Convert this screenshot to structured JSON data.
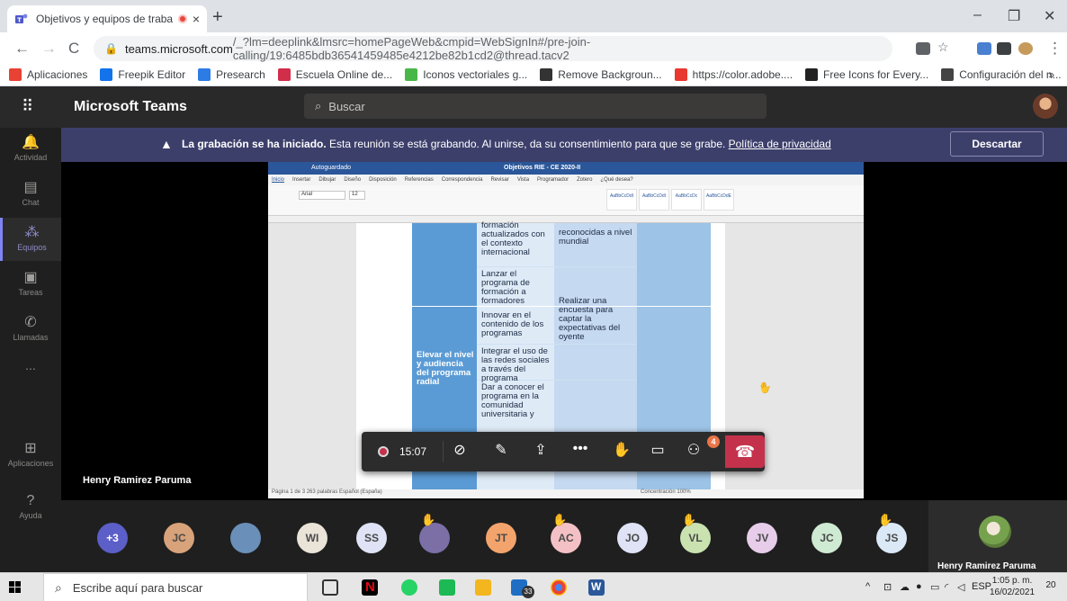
{
  "browser": {
    "tab_title": "Objetivos y equipos de traba",
    "tab_close": "×",
    "new_tab": "+",
    "win_minimize": "–",
    "win_restore": "❐",
    "win_close": "✕",
    "nav_back": "←",
    "nav_forward": "→",
    "nav_reload": "C",
    "url_host": "teams.microsoft.com",
    "url_rest": "/_?lm=deeplink&lmsrc=homePageWeb&cmpid=WebSignIn#/pre-join-calling/19:6485bdb36541459485e4212be82b1cd2@thread.tacv2",
    "more_menu": "⋮",
    "bookmarks": [
      {
        "label": "Aplicaciones",
        "color": "#e94235"
      },
      {
        "label": "Freepik Editor",
        "color": "#1273eb"
      },
      {
        "label": "Presearch",
        "color": "#2d7be5"
      },
      {
        "label": "Escuela Online de...",
        "color": "#d12e4a"
      },
      {
        "label": "Iconos vectoriales g...",
        "color": "#48b748"
      },
      {
        "label": "Remove Backgroun...",
        "color": "#333333"
      },
      {
        "label": "https://color.adobe....",
        "color": "#e8382f"
      },
      {
        "label": "Free Icons for Every...",
        "color": "#222222"
      },
      {
        "label": "Configuración del n...",
        "color": "#444444"
      }
    ],
    "bookmarks_more": "»"
  },
  "teams": {
    "app_name": "Microsoft Teams",
    "search_placeholder": "Buscar",
    "rail": [
      {
        "label": "Actividad",
        "icon": "bell-icon",
        "glyph": "🔔"
      },
      {
        "label": "Chat",
        "icon": "chat-icon",
        "glyph": "▤"
      },
      {
        "label": "Equipos",
        "icon": "teams-icon",
        "glyph": "⁂"
      },
      {
        "label": "Tareas",
        "icon": "tasks-icon",
        "glyph": "▣"
      },
      {
        "label": "Llamadas",
        "icon": "phone-icon",
        "glyph": "✆"
      },
      {
        "label": "Aplicaciones",
        "icon": "apps-icon",
        "glyph": "⊞"
      },
      {
        "label": "Ayuda",
        "icon": "help-icon",
        "glyph": "?"
      }
    ],
    "rail_more": "...",
    "banner": {
      "bold": "La grabación se ha iniciado.",
      "text": " Esta reunión se está grabando. Al unirse, da su consentimiento para que se grabe. ",
      "link": "Política de privacidad",
      "dismiss": "Descartar"
    },
    "speaker_name": "Henry Ramirez Paruma",
    "call": {
      "timer": "15:07",
      "participants_badge": "4",
      "controls": [
        {
          "name": "camera-off-icon",
          "glyph": "⊘"
        },
        {
          "name": "mic-off-icon",
          "glyph": "✎"
        },
        {
          "name": "share-screen-icon",
          "glyph": "⇪"
        },
        {
          "name": "more-actions-icon",
          "glyph": "•••"
        },
        {
          "name": "raise-hand-icon",
          "glyph": "✋"
        },
        {
          "name": "chat-toggle-icon",
          "glyph": "▭"
        },
        {
          "name": "participants-icon",
          "glyph": "⚇"
        }
      ],
      "hangup_glyph": "☎"
    },
    "participants": [
      {
        "initials": "+3",
        "color": "#5b5fc7",
        "hand": false
      },
      {
        "initials": "JC",
        "color": "#d8a27a",
        "hand": false
      },
      {
        "initials": "",
        "color": "#6a8fb8",
        "hand": false
      },
      {
        "initials": "WI",
        "color": "#e9e3d8",
        "hand": false
      },
      {
        "initials": "SS",
        "color": "#dfe3f5",
        "hand": false
      },
      {
        "initials": "",
        "color": "#7b6fa6",
        "hand": true
      },
      {
        "initials": "JT",
        "color": "#f3a46c",
        "hand": false
      },
      {
        "initials": "AC",
        "color": "#f3c1c5",
        "hand": true
      },
      {
        "initials": "JO",
        "color": "#dfe3f5",
        "hand": false
      },
      {
        "initials": "VL",
        "color": "#c9e2b0",
        "hand": true
      },
      {
        "initials": "JV",
        "color": "#e7cdea",
        "hand": false
      },
      {
        "initials": "JC",
        "color": "#cfead2",
        "hand": false
      },
      {
        "initials": "JS",
        "color": "#dbe9f7",
        "hand": true
      }
    ],
    "self_name": "Henry Ramirez Paruma"
  },
  "shared_doc": {
    "title": "Objetivos RIE - CE 2020-II",
    "autosave": "Autoguardado",
    "menu": [
      "Inicio",
      "Insertar",
      "Dibujar",
      "Diseño",
      "Disposición",
      "Referencias",
      "Correspondencia",
      "Revisar",
      "Vista",
      "Programador",
      "Zotero",
      "¿Qué desea?"
    ],
    "font": "Arial",
    "size": "12",
    "styles": [
      "AaBbCcDdI",
      "AaBbCcDdI",
      "AaBbCcDc",
      "AaBbCcDdE"
    ],
    "col1_cell": "Elevar el nivel y audiencia del programa radial",
    "col2_cells": [
      "formación actualizados con el contexto internacional",
      "Lanzar el programa de formación a formadores",
      "Innovar en el contenido de los programas",
      "Integrar el uso de las redes sociales a través del programa",
      "Dar a conocer el programa en la comunidad universitaria y"
    ],
    "col3_cells": [
      "reconocidas a nivel mundial",
      "Realizar una encuesta para captar la expectativas del oyente"
    ],
    "status_left": "Página 1 de 3   263 palabras   Español (España)",
    "status_right": "Concentración  100%"
  },
  "taskbar": {
    "search_placeholder": "Escribe aquí para buscar",
    "lang": "ESP",
    "time": "1:05 p. m.",
    "date": "16/02/2021",
    "notif_count": "20",
    "mail_count": "33"
  }
}
